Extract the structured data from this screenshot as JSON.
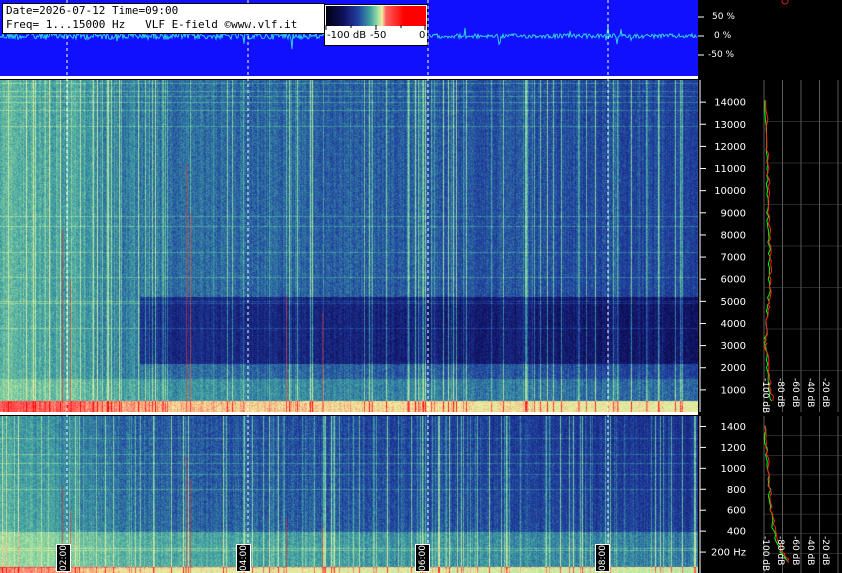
{
  "header": {
    "line1": "Date=2026-07-12 Time=09:00",
    "line2": "Freq= 1...15000 Hz   VLF E-field ©www.vlf.it"
  },
  "colorbar": {
    "ticks": [
      "-100 dB",
      "-50",
      "0"
    ]
  },
  "amplitude_labels": [
    "50 %",
    "0 %",
    "-50 %"
  ],
  "chart_data": [
    {
      "type": "heatmap",
      "title": "",
      "xlabel": "",
      "ylabel": "",
      "x_tick_labels": [
        "02:00",
        "04:00",
        "06:00",
        "08:00"
      ],
      "ylim": [
        0,
        15000
      ],
      "y_ticks": [
        1000,
        2000,
        3000,
        4000,
        5000,
        6000,
        7000,
        8000,
        9000,
        10000,
        11000,
        12000,
        13000,
        14000
      ],
      "y_tick_labels": [
        "1000",
        "2000",
        "3000",
        "4000",
        "5000",
        "6000",
        "7000",
        "8000",
        "9000",
        "10000",
        "11000",
        "12000",
        "13000",
        "14000"
      ],
      "colorscale": [
        "#000010",
        "#101060",
        "#2040a0",
        "#3fa0a0",
        "#a0e0a0",
        "#f0f0a0",
        "#ff6060",
        "#ff0000"
      ],
      "time_range_hours": [
        0,
        9
      ],
      "quiet_band_hz": [
        2200,
        5200
      ],
      "quiet_band_start_hour": 1.8
    },
    {
      "type": "heatmap",
      "title": "",
      "xlabel": "",
      "ylabel": "",
      "x_tick_labels": [
        "02:00",
        "04:00",
        "06:00",
        "08:00"
      ],
      "ylim": [
        0,
        1500
      ],
      "y_ticks": [
        200,
        400,
        600,
        800,
        1000,
        1200,
        1400
      ],
      "y_tick_labels": [
        "200 Hz",
        "400",
        "600",
        "800",
        "1000",
        "1200",
        "1400"
      ]
    },
    {
      "type": "line",
      "title": "",
      "x_tick_labels": [
        "-100 dB",
        "-80 dB",
        "-60 dB",
        "-40 dB",
        "-20 dB"
      ],
      "xlim": [
        -100,
        -20
      ],
      "ylim": [
        0,
        15000
      ],
      "series": [
        {
          "color": "#00ff00",
          "x": [
            -92,
            -94,
            -96,
            -99,
            -98,
            -97,
            -95,
            -94,
            -94,
            -95,
            -96,
            -96,
            -96,
            -97,
            -98
          ],
          "y": [
            500,
            1000,
            2000,
            3000,
            3500,
            4500,
            5000,
            6000,
            7000,
            8000,
            9000,
            10000,
            11000,
            12000,
            14500
          ]
        },
        {
          "color": "#ff2020",
          "x": [
            -90,
            -93,
            -95,
            -98,
            -97,
            -96,
            -94,
            -93,
            -93,
            -94,
            -95,
            -95,
            -95,
            -96,
            -97
          ],
          "y": [
            500,
            1000,
            2000,
            3000,
            3500,
            4500,
            5000,
            6000,
            7000,
            8000,
            9000,
            10000,
            11000,
            12000,
            14500
          ]
        }
      ]
    },
    {
      "type": "line",
      "title": "",
      "x_tick_labels": [
        "-100 dB",
        "-80 dB",
        "-60 dB",
        "-40 dB",
        "-20 dB"
      ],
      "xlim": [
        -100,
        -20
      ],
      "ylim": [
        0,
        1500
      ],
      "series": [
        {
          "color": "#00ff00",
          "x": [
            -74,
            -82,
            -90,
            -93,
            -94,
            -96,
            -98,
            -99
          ],
          "y": [
            100,
            200,
            400,
            600,
            800,
            1000,
            1200,
            1450
          ]
        },
        {
          "color": "#ff2020",
          "x": [
            -72,
            -80,
            -88,
            -92,
            -93,
            -95,
            -97,
            -98
          ],
          "y": [
            100,
            200,
            400,
            600,
            800,
            1000,
            1200,
            1450
          ]
        }
      ]
    }
  ]
}
